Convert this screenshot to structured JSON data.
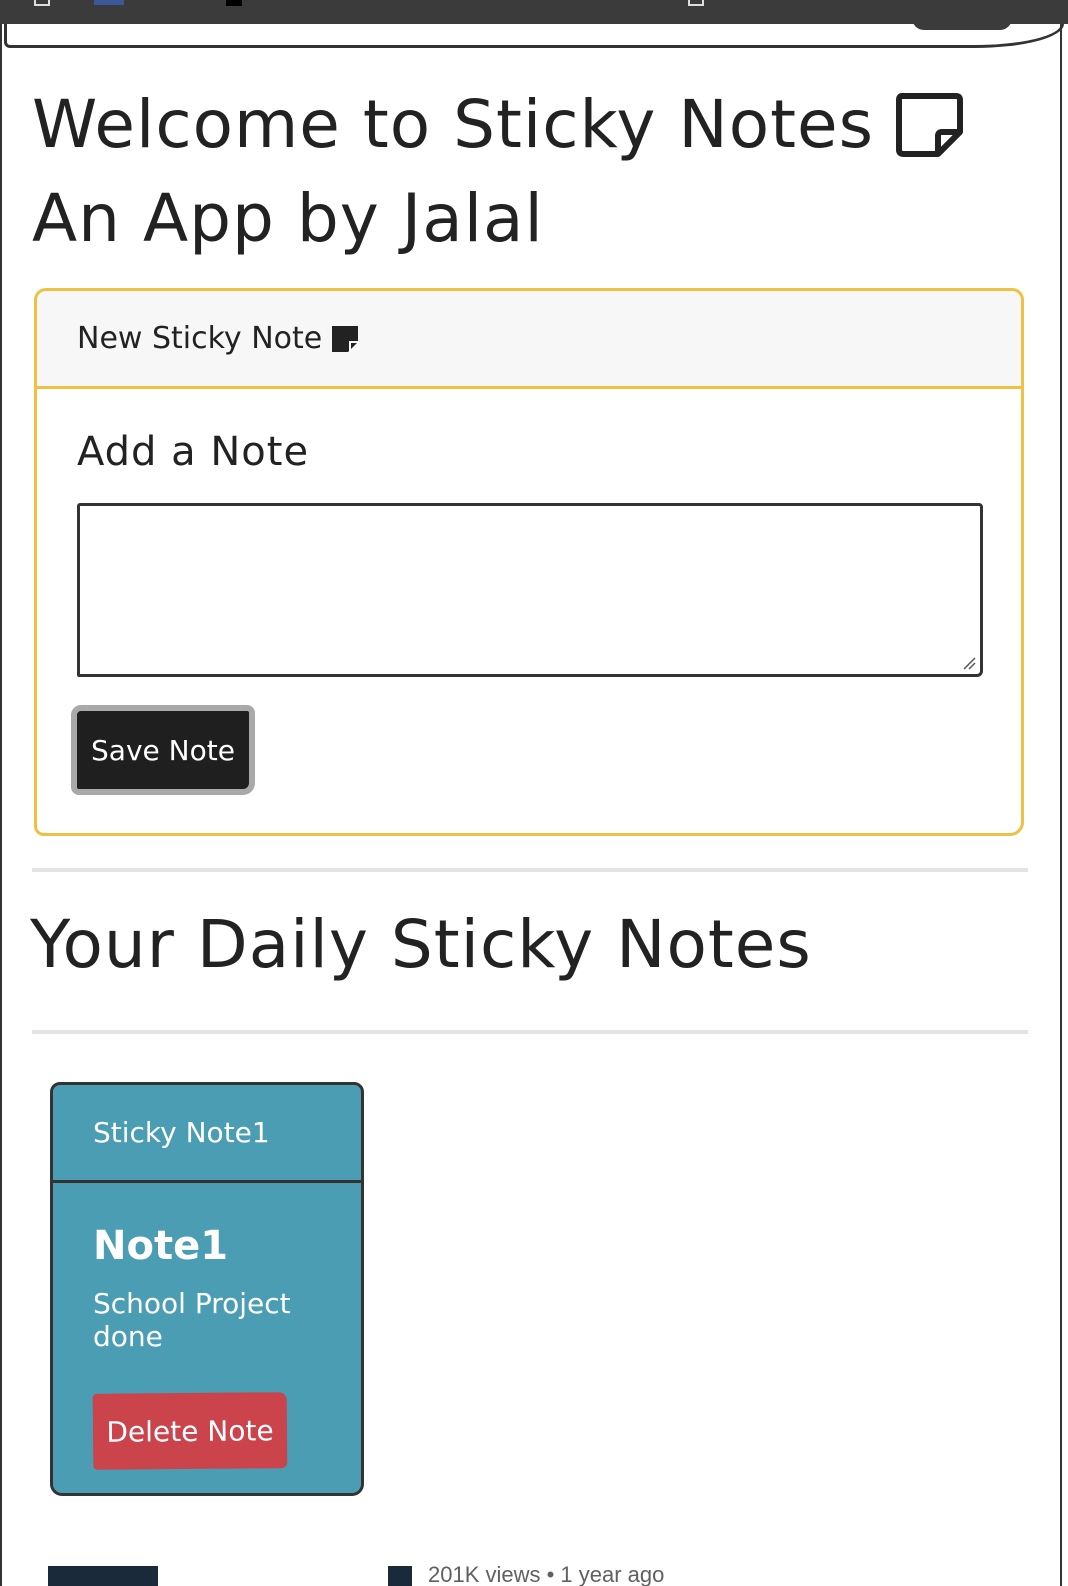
{
  "hero": {
    "line1": "Welcome to Sticky Notes",
    "line2": "An App by Jalal"
  },
  "new_note_card": {
    "header": "New Sticky Note",
    "title": "Add a Note",
    "textarea_value": "",
    "save_label": "Save Note"
  },
  "section_title": "Your Daily Sticky Notes",
  "notes": [
    {
      "header": "Sticky Note1",
      "title": "Note1",
      "text": "School Project done",
      "delete_label": "Delete Note"
    }
  ],
  "bottom_peek": {
    "meta": "201K views • 1 year ago"
  },
  "colors": {
    "card_border": "#f0c040",
    "sticky_bg": "#4a9db3",
    "delete_btn": "#cc444b",
    "save_btn": "#1f1f1f"
  },
  "icons": {
    "hero_icon": "sticky-note-outline-icon",
    "header_icon": "sticky-note-filled-icon"
  }
}
